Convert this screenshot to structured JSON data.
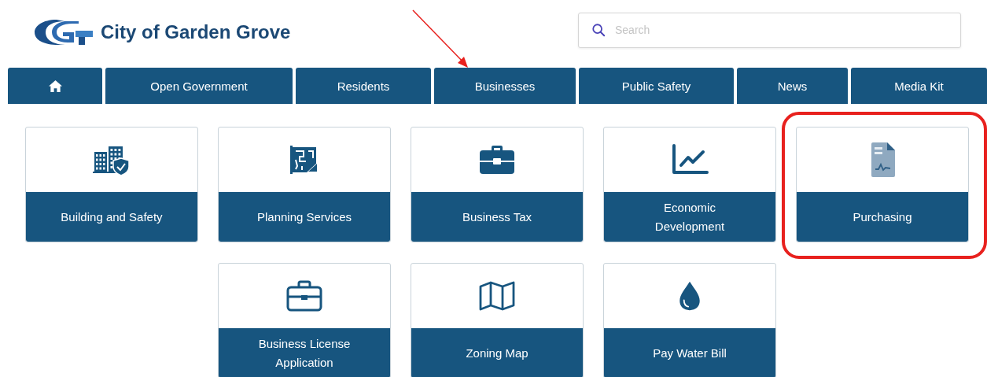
{
  "site_title": "City of Garden Grove",
  "search": {
    "placeholder": "Search"
  },
  "nav": [
    {
      "kind": "home"
    },
    {
      "kind": "text",
      "label": "Open Government",
      "arrow": false
    },
    {
      "kind": "text",
      "label": "Residents",
      "arrow": false
    },
    {
      "kind": "text",
      "label": "Businesses",
      "arrow": true
    },
    {
      "kind": "text",
      "label": "Public Safety",
      "arrow": false
    },
    {
      "kind": "text",
      "label": "News",
      "arrow": false
    },
    {
      "kind": "text",
      "label": "Media Kit",
      "arrow": false
    }
  ],
  "tile_rows": [
    [
      {
        "kind": "building",
        "label": "Building and Safety",
        "highlighted": false
      },
      {
        "kind": "blueprint",
        "label": "Planning Services",
        "highlighted": false
      },
      {
        "kind": "briefcase",
        "label": "Business Tax",
        "highlighted": false
      },
      {
        "kind": "chart",
        "label": "Economic Development",
        "highlighted": false
      },
      {
        "kind": "document",
        "label": "Purchasing",
        "highlighted": true
      }
    ],
    [
      {
        "kind": "case",
        "label": "Business License Application",
        "highlighted": false
      },
      {
        "kind": "map",
        "label": "Zoning Map",
        "highlighted": false
      },
      {
        "kind": "drop",
        "label": "Pay Water Bill",
        "highlighted": false
      }
    ]
  ]
}
